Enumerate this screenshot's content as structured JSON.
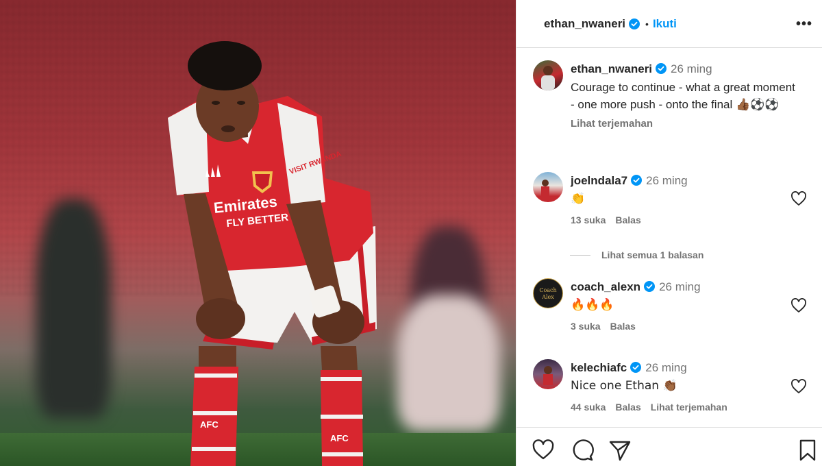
{
  "post": {
    "author": "ethan_nwaneri",
    "follow_label": "Ikuti",
    "more_label": "•••",
    "separator": "•"
  },
  "caption": {
    "username": "ethan_nwaneri",
    "time": "26 ming",
    "text": "Courage to continue - what a great moment - one more push - onto the final",
    "emoji": "👍🏾⚽⚽",
    "translate": "Lihat terjemahan"
  },
  "comments": [
    {
      "username": "joelndala7",
      "time": "26 ming",
      "text": "👏",
      "likes": "13 suka",
      "reply": "Balas",
      "translate": ""
    },
    {
      "username": "coach_alexn",
      "time": "26 ming",
      "text": "🔥🔥🔥",
      "likes": "3 suka",
      "reply": "Balas",
      "translate": "",
      "avatar_text": "Coach Alex"
    },
    {
      "username": "kelechiafc",
      "time": "26 ming",
      "text": "Nice one Ethan 👏🏾",
      "likes": "44 suka",
      "reply": "Balas",
      "translate": "Lihat terjemahan"
    }
  ],
  "view_replies": "Lihat semua 1 balasan",
  "photo": {
    "shirt_sponsor_line1": "Emirates",
    "shirt_sponsor_line2": "FLY BETTER",
    "sleeve_text": "VISIT RWANDA",
    "sock_text": "AFC"
  },
  "colors": {
    "accent": "#0095f6",
    "verified": "#0095f6",
    "text": "#262626",
    "muted": "#737373",
    "shirt_red": "#d8262f"
  },
  "icons": [
    "verified-icon",
    "more-icon",
    "heart-icon",
    "comment-icon",
    "share-icon",
    "bookmark-icon"
  ]
}
